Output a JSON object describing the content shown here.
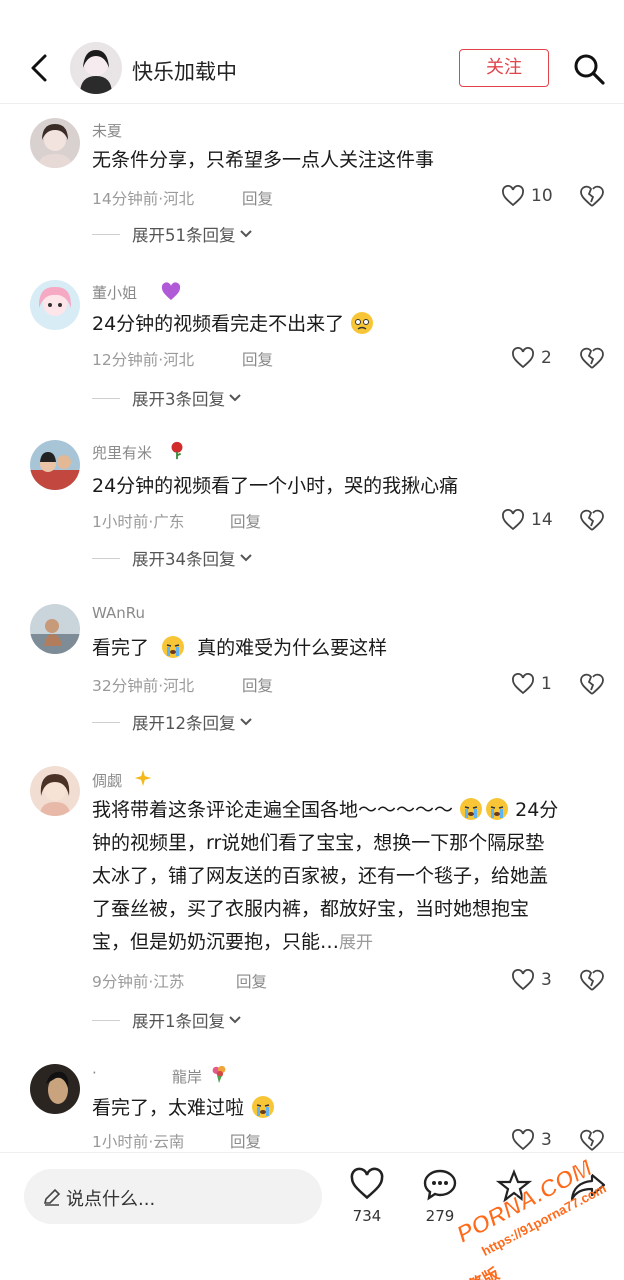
{
  "header": {
    "name": "快乐加载中",
    "follow": "关注"
  },
  "comments": [
    {
      "user": "未夏",
      "text": [
        "无条件分享，只希望多一点人关注这件事"
      ],
      "time": "14分钟前",
      "location": "河北",
      "reply": "回复",
      "likes": "10",
      "expand": "展开51条回复"
    },
    {
      "user": "董小姐",
      "text": [
        "24分钟的视频看完走不出来了"
      ],
      "time": "12分钟前",
      "location": "河北",
      "reply": "回复",
      "likes": "2",
      "expand": "展开3条回复"
    },
    {
      "user": "兜里有米",
      "text": [
        "24分钟的视频看了一个小时，哭的我揪心痛"
      ],
      "time": "1小时前",
      "location": "广东",
      "reply": "回复",
      "likes": "14",
      "expand": "展开34条回复"
    },
    {
      "user": "WAnRu",
      "text_a": "看完了",
      "text_b": "真的难受为什么要这样",
      "time": "32分钟前",
      "location": "河北",
      "reply": "回复",
      "likes": "1",
      "expand": "展开12条回复"
    },
    {
      "user": "倜觑",
      "line1": "我将带着这条评论走遍全国各地～～～～～",
      "line1_tail": "24分",
      "line2": "钟的视频里，rr说她们看了宝宝，想换一下那个隔尿垫",
      "line3": "太冰了，铺了网友送的百家被，还有一个毯子，给她盖",
      "line4": "了蚕丝被，买了衣服内裤，都放好宝，当时她想抱宝",
      "line5": "宝，但是奶奶沉要抱，只能…",
      "more": "展开",
      "time": "9分钟前",
      "location": "江苏",
      "reply": "回复",
      "likes": "3",
      "expand": "展开1条回复"
    },
    {
      "user_dot": "·",
      "user": "龍岸",
      "text": "看完了，太难过啦",
      "time": "1小时前",
      "location": "云南",
      "reply": "回复",
      "likes": "3"
    }
  ],
  "bottom": {
    "placeholder": "说点什么...",
    "likes": "734",
    "comments": "279"
  },
  "watermark": {
    "brand": "PORNA.COM",
    "url": "https://91porna77.com",
    "tag": "看完整版"
  },
  "colors": {
    "accent": "#e0454c",
    "muted": "#9a9a9a"
  }
}
